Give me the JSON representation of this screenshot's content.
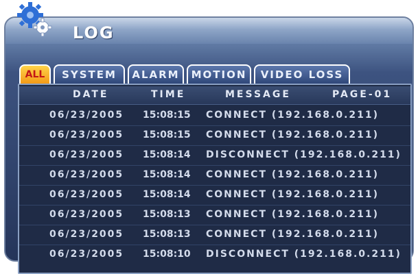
{
  "title": "LOG",
  "icons": {
    "logo": "gear-icon"
  },
  "tabs": [
    {
      "label": "ALL",
      "active": true
    },
    {
      "label": "SYSTEM",
      "active": false
    },
    {
      "label": "ALARM",
      "active": false
    },
    {
      "label": "MOTION",
      "active": false
    },
    {
      "label": "VIDEO LOSS",
      "active": false
    }
  ],
  "table": {
    "headers": {
      "date": "DATE",
      "time": "TIME",
      "message": "MESSAGE",
      "page": "PAGE-01"
    },
    "rows": [
      {
        "date": "06/23/2005",
        "time": "15:08:15",
        "message": "CONNECT  (192.168.0.211)"
      },
      {
        "date": "06/23/2005",
        "time": "15:08:15",
        "message": "CONNECT  (192.168.0.211)"
      },
      {
        "date": "06/23/2005",
        "time": "15:08:14",
        "message": "DISCONNECT  (192.168.0.211)"
      },
      {
        "date": "06/23/2005",
        "time": "15:08:14",
        "message": "CONNECT  (192.168.0.211)"
      },
      {
        "date": "06/23/2005",
        "time": "15:08:14",
        "message": "CONNECT  (192.168.0.211)"
      },
      {
        "date": "06/23/2005",
        "time": "15:08:13",
        "message": "CONNECT  (192.168.0.211)"
      },
      {
        "date": "06/23/2005",
        "time": "15:08:13",
        "message": "CONNECT  (192.168.0.211)"
      },
      {
        "date": "06/23/2005",
        "time": "15:08:10",
        "message": "DISCONNECT  (192.168.0.211)"
      }
    ]
  },
  "colors": {
    "active_tab": "#f5a623",
    "active_tab_text": "#c31616",
    "panel_bg": "#1f2b46",
    "frame": "#3d5380"
  }
}
